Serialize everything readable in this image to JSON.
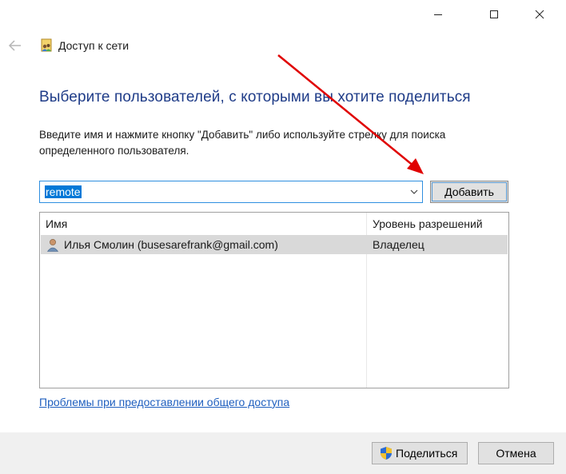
{
  "window": {
    "title": "Доступ к сети",
    "controls": [
      "minimize",
      "maximize",
      "close"
    ]
  },
  "heading": "Выберите пользователей, с которыми вы хотите поделиться",
  "instructions": "Введите имя и нажмите кнопку \"Добавить\" либо используйте стрелку для поиска определенного пользователя.",
  "name_input": {
    "value": "remote"
  },
  "add_button_label": "Добавить",
  "table": {
    "headers": {
      "name": "Имя",
      "permission": "Уровень разрешений"
    },
    "rows": [
      {
        "name": "Илья Смолин (busesarefrank@gmail.com)",
        "permission": "Владелец",
        "selected": true
      }
    ]
  },
  "help_link": "Проблемы при предоставлении общего доступа",
  "footer": {
    "share_label": "Поделиться",
    "cancel_label": "Отмена"
  },
  "colors": {
    "heading": "#1f3c88",
    "link": "#1f5fbf",
    "selection": "#0078d7",
    "annotation_arrow": "#e00000"
  },
  "icons": [
    "back-arrow-icon",
    "network-share-icon",
    "dropdown-chevron-icon",
    "user-icon",
    "uac-shield-icon"
  ]
}
